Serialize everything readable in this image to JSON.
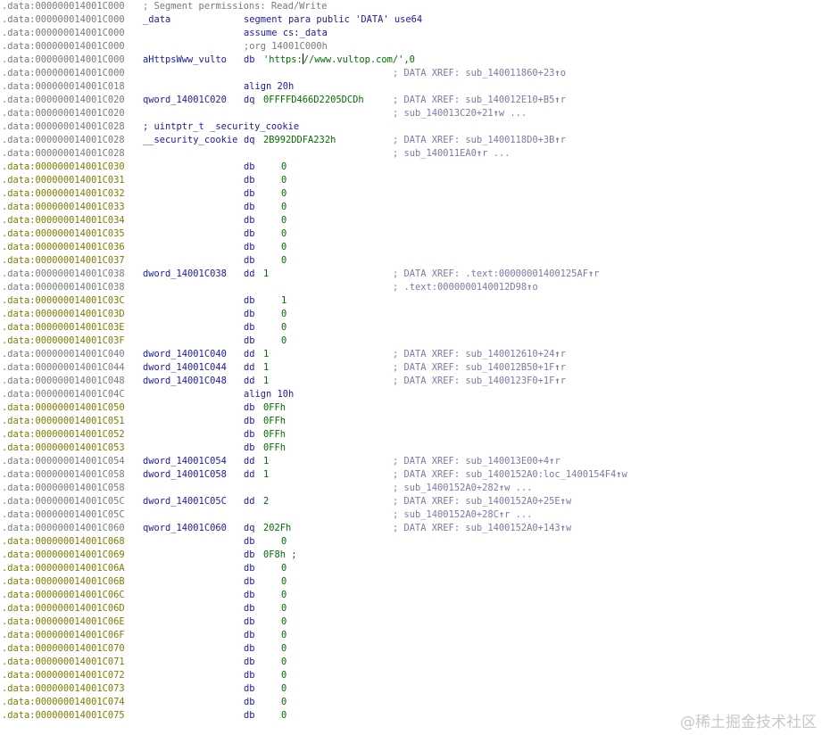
{
  "rows": [
    {
      "addr": ".data:000000014001C000",
      "kind": "data",
      "hdr": "; Segment permissions: Read/Write"
    },
    {
      "addr": ".data:000000014001C000",
      "kind": "data",
      "label": "_data",
      "mn": "segment para public 'DATA' use64",
      "mnCol": "wide"
    },
    {
      "addr": ".data:000000014001C000",
      "kind": "data",
      "mn": "assume cs:_data",
      "mnCol": "wide"
    },
    {
      "addr": ".data:000000014001C000",
      "kind": "data",
      "mn": ";org 14001C000h",
      "mnCol": "wide",
      "mnGray": true
    },
    {
      "addr": ".data:000000014001C000",
      "kind": "data",
      "highlight": true,
      "label": "aHttpsWww_vulto",
      "mn": "db",
      "str": "'https://www.vultop.com/',0"
    },
    {
      "addr": ".data:000000014001C000",
      "kind": "data",
      "cmt": "; DATA XREF: sub_140011860+23",
      "arrow": "↑",
      "suffix": "o"
    },
    {
      "addr": ".data:000000014001C018",
      "kind": "data",
      "mn": "align 20h",
      "mnCol": "wide"
    },
    {
      "addr": ".data:000000014001C020",
      "kind": "data",
      "label": "qword_14001C020",
      "mn": "dq",
      "op": "0FFFFD466D2205DCDh",
      "opCol": "near",
      "cmt": "; DATA XREF: sub_140012E10+B5",
      "arrow": "↑",
      "suffix": "r"
    },
    {
      "addr": ".data:000000014001C020",
      "kind": "data",
      "cmt": "; sub_140013C20+21",
      "arrow": "↑",
      "suffix": "w ..."
    },
    {
      "addr": ".data:000000014001C028",
      "kind": "data",
      "label": "; uintptr_t _security_cookie"
    },
    {
      "addr": ".data:000000014001C028",
      "kind": "data",
      "label": "__security_cookie",
      "mn": "dq",
      "op": "2B992DDFA232h",
      "opCol": "near",
      "cmt": "; DATA XREF: sub_1400118D0+3B",
      "arrow": "↑",
      "suffix": "r"
    },
    {
      "addr": ".data:000000014001C028",
      "kind": "data",
      "cmt": "; sub_140011EA0",
      "arrow": "↑",
      "suffix": "r ..."
    },
    {
      "addr": ".data:000000014001C030",
      "kind": "code",
      "mn": "db",
      "op": "0"
    },
    {
      "addr": ".data:000000014001C031",
      "kind": "code",
      "mn": "db",
      "op": "0"
    },
    {
      "addr": ".data:000000014001C032",
      "kind": "code",
      "mn": "db",
      "op": "0"
    },
    {
      "addr": ".data:000000014001C033",
      "kind": "code",
      "mn": "db",
      "op": "0"
    },
    {
      "addr": ".data:000000014001C034",
      "kind": "code",
      "mn": "db",
      "op": "0"
    },
    {
      "addr": ".data:000000014001C035",
      "kind": "code",
      "mn": "db",
      "op": "0"
    },
    {
      "addr": ".data:000000014001C036",
      "kind": "code",
      "mn": "db",
      "op": "0"
    },
    {
      "addr": ".data:000000014001C037",
      "kind": "code",
      "mn": "db",
      "op": "0"
    },
    {
      "addr": ".data:000000014001C038",
      "kind": "data",
      "label": "dword_14001C038",
      "mn": "dd",
      "op": "1",
      "opCol": "near",
      "cmt": "; DATA XREF: .text:00000001400125AF",
      "arrow": "↑",
      "suffix": "r"
    },
    {
      "addr": ".data:000000014001C038",
      "kind": "data",
      "cmt": "; .text:0000000140012D98",
      "arrow": "↑",
      "suffix": "o"
    },
    {
      "addr": ".data:000000014001C03C",
      "kind": "code",
      "mn": "db",
      "op": "1"
    },
    {
      "addr": ".data:000000014001C03D",
      "kind": "code",
      "mn": "db",
      "op": "0"
    },
    {
      "addr": ".data:000000014001C03E",
      "kind": "code",
      "mn": "db",
      "op": "0"
    },
    {
      "addr": ".data:000000014001C03F",
      "kind": "code",
      "mn": "db",
      "op": "0"
    },
    {
      "addr": ".data:000000014001C040",
      "kind": "data",
      "label": "dword_14001C040",
      "mn": "dd",
      "op": "1",
      "opCol": "near",
      "cmt": "; DATA XREF: sub_140012610+24",
      "arrow": "↑",
      "suffix": "r"
    },
    {
      "addr": ".data:000000014001C044",
      "kind": "data",
      "label": "dword_14001C044",
      "mn": "dd",
      "op": "1",
      "opCol": "near",
      "cmt": "; DATA XREF: sub_140012B50+1F",
      "arrow": "↑",
      "suffix": "r"
    },
    {
      "addr": ".data:000000014001C048",
      "kind": "data",
      "label": "dword_14001C048",
      "mn": "dd",
      "op": "1",
      "opCol": "near",
      "cmt": "; DATA XREF: sub_1400123F0+1F",
      "arrow": "↑",
      "suffix": "r"
    },
    {
      "addr": ".data:000000014001C04C",
      "kind": "data",
      "mn": "align 10h",
      "mnCol": "wide"
    },
    {
      "addr": ".data:000000014001C050",
      "kind": "code",
      "mn": "db",
      "op": "0FFh",
      "opCol": "near"
    },
    {
      "addr": ".data:000000014001C051",
      "kind": "code",
      "mn": "db",
      "op": "0FFh",
      "opCol": "near"
    },
    {
      "addr": ".data:000000014001C052",
      "kind": "code",
      "mn": "db",
      "op": "0FFh",
      "opCol": "near"
    },
    {
      "addr": ".data:000000014001C053",
      "kind": "code",
      "mn": "db",
      "op": "0FFh",
      "opCol": "near"
    },
    {
      "addr": ".data:000000014001C054",
      "kind": "data",
      "label": "dword_14001C054",
      "mn": "dd",
      "op": "1",
      "opCol": "near",
      "cmt": "; DATA XREF: sub_140013E00+4",
      "arrow": "↑",
      "suffix": "r"
    },
    {
      "addr": ".data:000000014001C058",
      "kind": "data",
      "label": "dword_14001C058",
      "mn": "dd",
      "op": "1",
      "opCol": "near",
      "cmt": "; DATA XREF: sub_1400152A0:loc_1400154F4",
      "arrow": "↑",
      "suffix": "w"
    },
    {
      "addr": ".data:000000014001C058",
      "kind": "data",
      "cmt": "; sub_1400152A0+282",
      "arrow": "↑",
      "suffix": "w ..."
    },
    {
      "addr": ".data:000000014001C05C",
      "kind": "data",
      "label": "dword_14001C05C",
      "mn": "dd",
      "op": "2",
      "opCol": "near",
      "cmt": "; DATA XREF: sub_1400152A0+25E",
      "arrow": "↑",
      "suffix": "w"
    },
    {
      "addr": ".data:000000014001C05C",
      "kind": "data",
      "cmt": "; sub_1400152A0+28C",
      "arrow": "↑",
      "suffix": "r ..."
    },
    {
      "addr": ".data:000000014001C060",
      "kind": "data",
      "label": "qword_14001C060",
      "mn": "dq",
      "op": "202Fh",
      "opCol": "near",
      "cmt": "; DATA XREF: sub_1400152A0+143",
      "arrow": "↑",
      "suffix": "w"
    },
    {
      "addr": ".data:000000014001C068",
      "kind": "code",
      "mn": "db",
      "op": "0"
    },
    {
      "addr": ".data:000000014001C069",
      "kind": "code",
      "mn": "db",
      "op": "0F8h ;",
      "opCol": "near"
    },
    {
      "addr": ".data:000000014001C06A",
      "kind": "code",
      "mn": "db",
      "op": "0"
    },
    {
      "addr": ".data:000000014001C06B",
      "kind": "code",
      "mn": "db",
      "op": "0"
    },
    {
      "addr": ".data:000000014001C06C",
      "kind": "code",
      "mn": "db",
      "op": "0"
    },
    {
      "addr": ".data:000000014001C06D",
      "kind": "code",
      "mn": "db",
      "op": "0"
    },
    {
      "addr": ".data:000000014001C06E",
      "kind": "code",
      "mn": "db",
      "op": "0"
    },
    {
      "addr": ".data:000000014001C06F",
      "kind": "code",
      "mn": "db",
      "op": "0"
    },
    {
      "addr": ".data:000000014001C070",
      "kind": "code",
      "mn": "db",
      "op": "0"
    },
    {
      "addr": ".data:000000014001C071",
      "kind": "code",
      "mn": "db",
      "op": "0"
    },
    {
      "addr": ".data:000000014001C072",
      "kind": "code",
      "mn": "db",
      "op": "0"
    },
    {
      "addr": ".data:000000014001C073",
      "kind": "code",
      "mn": "db",
      "op": "0"
    },
    {
      "addr": ".data:000000014001C074",
      "kind": "code",
      "mn": "db",
      "op": "0"
    },
    {
      "addr": ".data:000000014001C075",
      "kind": "code",
      "mn": "db",
      "op": "0"
    }
  ],
  "watermark": "@稀土掘金技术社区",
  "colors": {
    "address_gray": "#7a7a7a",
    "address_undefined": "#7d7d00",
    "label_blue": "#1a1aa6",
    "operand_green": "#007000",
    "xref_comment": "#7a7aa8"
  }
}
